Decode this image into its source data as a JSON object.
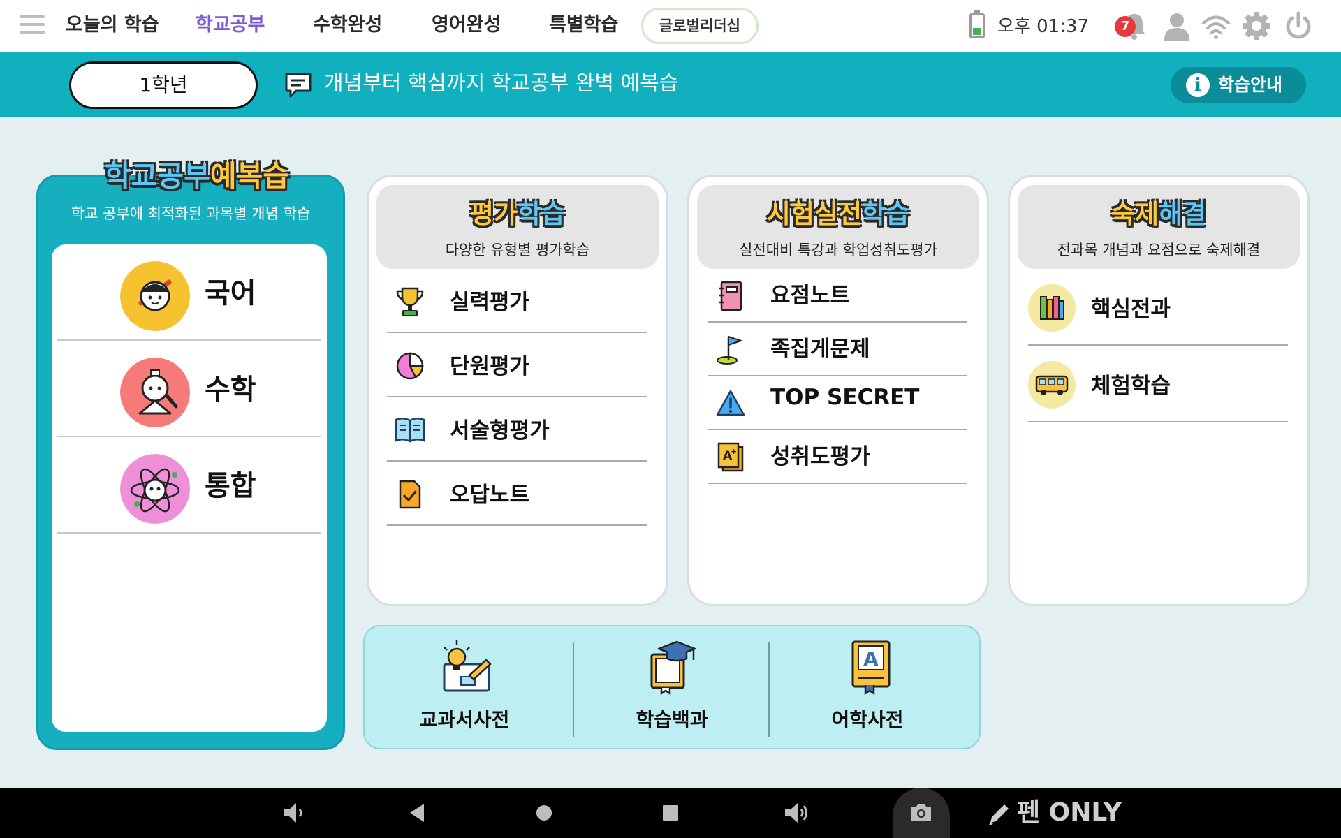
{
  "top_nav": {
    "tabs": [
      {
        "label": "오늘의 학습",
        "active": false
      },
      {
        "label": "학교공부",
        "active": true
      },
      {
        "label": "수학완성",
        "active": false
      },
      {
        "label": "영어완성",
        "active": false
      },
      {
        "label": "특별학습",
        "active": false
      }
    ],
    "pill_tab": "글로벌리더십",
    "time": "오후 01:37",
    "notification_count": "7",
    "icons": [
      "menu-icon",
      "battery-icon",
      "bell-icon",
      "profile-icon",
      "wifi-icon",
      "gear-icon",
      "power-icon"
    ],
    "active_color": "#7b5cd6"
  },
  "banner": {
    "grade": "1학년",
    "message": "개념부터 핵심까지 학교공부 완벽 예복습",
    "guide_button": "학습안내",
    "color": "#11b0bf"
  },
  "review": {
    "title_main": "학교공부",
    "title_highlight": "예복습",
    "subtitle": "학교 공부에 최적화된 과목별 개념 학습",
    "subjects": [
      {
        "label": "국어",
        "icon": "korean-character-icon",
        "color": "#f6c230"
      },
      {
        "label": "수학",
        "icon": "math-character-icon",
        "color": "#f77a7a"
      },
      {
        "label": "통합",
        "icon": "integrated-character-icon",
        "color": "#ee8fd8"
      }
    ]
  },
  "cards": {
    "evaluation": {
      "title_a": "평가",
      "title_b": "학습",
      "subtitle": "다양한 유형별 평가학습",
      "items": [
        {
          "label": "실력평가",
          "icon": "trophy-icon"
        },
        {
          "label": "단원평가",
          "icon": "pie-chart-icon"
        },
        {
          "label": "서술형평가",
          "icon": "open-book-icon"
        },
        {
          "label": "오답노트",
          "icon": "checked-document-icon"
        }
      ]
    },
    "exam": {
      "title_a": "시험실전",
      "title_b": "학습",
      "subtitle": "실전대비 특강과 학업성취도평가",
      "items": [
        {
          "label": "요점노트",
          "icon": "notebook-icon"
        },
        {
          "label": "족집게문제",
          "icon": "golf-flag-icon"
        },
        {
          "label": "TOP SECRET",
          "icon": "warning-icon"
        },
        {
          "label": "성취도평가",
          "icon": "a-plus-icon"
        }
      ]
    },
    "homework": {
      "title_a": "숙제",
      "title_b": "해결",
      "subtitle": "전과목 개념과 요점으로 숙제해결",
      "items": [
        {
          "label": "핵심전과",
          "icon": "books-icon"
        },
        {
          "label": "체험학습",
          "icon": "bus-icon"
        }
      ]
    }
  },
  "dictionaries": [
    {
      "label": "교과서사전",
      "icon": "textbook-idea-icon"
    },
    {
      "label": "학습백과",
      "icon": "encyclopedia-icon"
    },
    {
      "label": "어학사전",
      "icon": "language-dictionary-icon"
    }
  ],
  "system_bar": {
    "buttons": [
      "volume-down-icon",
      "back-icon",
      "home-icon",
      "recents-icon",
      "volume-up-icon",
      "camera-icon"
    ],
    "pen_label": "펜 ONLY"
  }
}
